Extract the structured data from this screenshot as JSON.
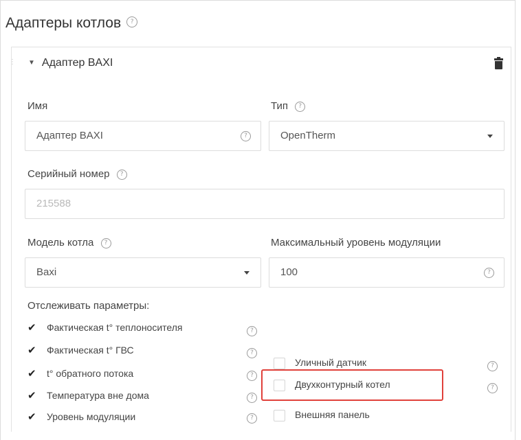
{
  "section": {
    "title": "Адаптеры котлов",
    "help_icon": "question-circle-icon"
  },
  "adapter": {
    "header": "Адаптер BAXI",
    "name_label": "Имя",
    "name_value": "Адаптер BAXI",
    "type_label": "Тип",
    "type_value": "OpenTherm",
    "serial_label": "Серийный номер",
    "serial_value": "215588",
    "model_label": "Модель котла",
    "model_value": "Baxi",
    "modulation_label": "Максимальный уровень модуляции",
    "modulation_value": "100",
    "track_label": "Отслеживать параметры:",
    "tracked": [
      {
        "label": "Фактическая t° теплоносителя",
        "checked": true
      },
      {
        "label": "Фактическая t° ГВС",
        "checked": true
      },
      {
        "label": "t° обратного потока",
        "checked": true
      },
      {
        "label": "Температура вне дома",
        "checked": true
      },
      {
        "label": "Уровень модуляции",
        "checked": true
      }
    ],
    "options": [
      {
        "label": "Уличный датчик",
        "checked": false
      },
      {
        "label": "Двухконтурный котел",
        "checked": false,
        "highlighted": true
      },
      {
        "label": "Внешняя панель",
        "checked": false
      }
    ]
  },
  "help_glyph": "?",
  "check_glyph": "✔",
  "colors": {
    "highlight": "#e0403a",
    "border": "#dcdcdc"
  }
}
